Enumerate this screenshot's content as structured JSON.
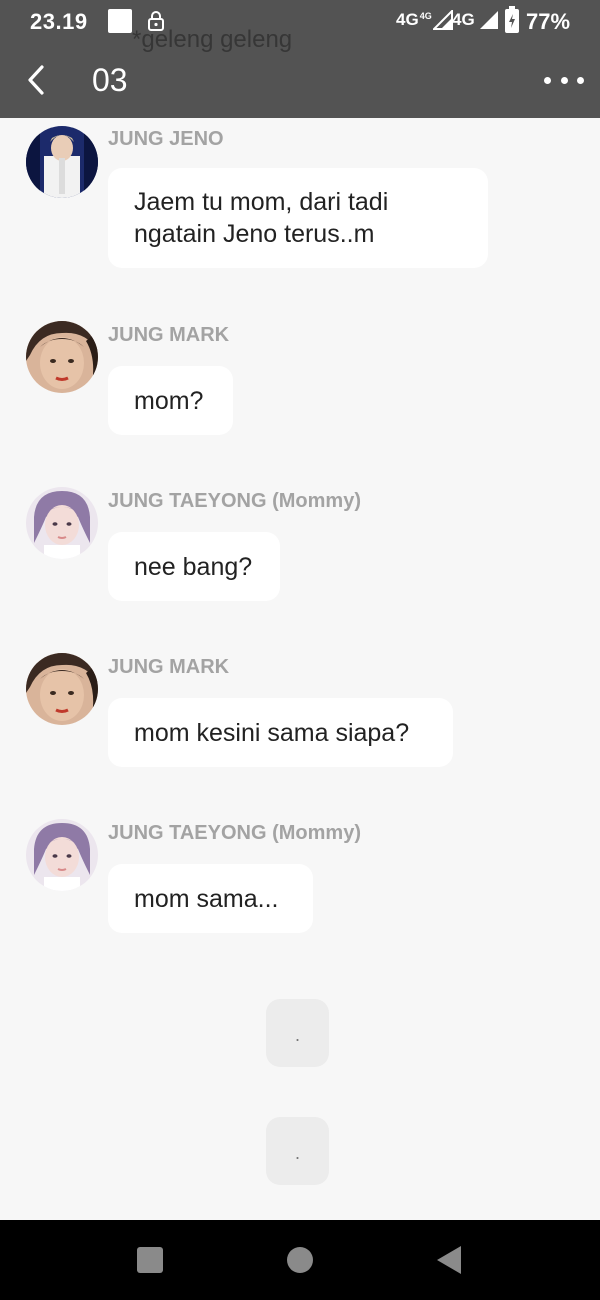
{
  "status_bar": {
    "time": "23.19",
    "network_1": "4G",
    "network_1_sup": "4G",
    "network_2": "4G",
    "battery": "77%"
  },
  "overlay": {
    "ghost_text": "*geleng geleng"
  },
  "app_bar": {
    "title": "03"
  },
  "messages": [
    {
      "sender": "JUNG JENO",
      "text": "Jaem tu mom, dari tadi\nngatain Jeno terus..m",
      "avatar": "avatar-jeno"
    },
    {
      "sender": "JUNG MARK",
      "text": "mom?",
      "avatar": "avatar-mark"
    },
    {
      "sender": "JUNG TAEYONG (Mommy)",
      "text": "nee bang?",
      "avatar": "avatar-taeyong"
    },
    {
      "sender": "JUNG MARK",
      "text": "mom kesini sama siapa?",
      "avatar": "avatar-mark"
    },
    {
      "sender": "JUNG TAEYONG (Mommy)",
      "text": "mom sama...",
      "avatar": "avatar-taeyong"
    }
  ],
  "narration": [
    {
      "text": "."
    },
    {
      "text": "."
    }
  ],
  "colors": {
    "header_bg": "#535353",
    "chat_bg": "#f7f7f7",
    "bubble_bg": "#ffffff",
    "sender_text": "#a3a3a3",
    "nav_bg": "#000000"
  },
  "icons": {
    "back": "chevron-left-icon",
    "more": "more-horizontal-icon",
    "lock": "lock-icon",
    "signal": "signal-icon",
    "battery": "battery-charging-icon",
    "nav_recent": "square-icon",
    "nav_home": "circle-icon",
    "nav_back": "triangle-back-icon"
  }
}
